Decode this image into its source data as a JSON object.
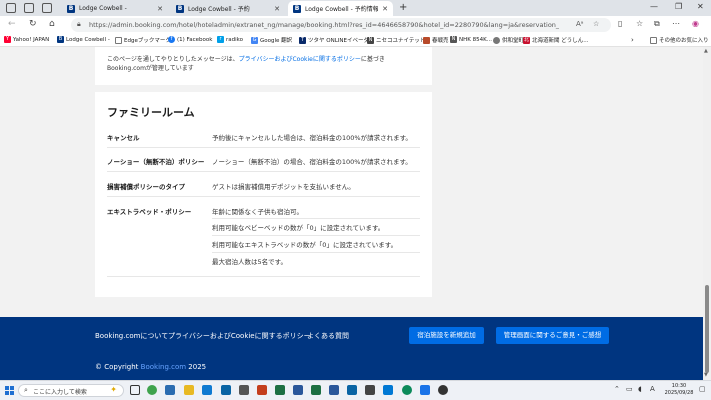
{
  "browser": {
    "tabs": [
      {
        "title": "Lodge Cowbell -",
        "active": false
      },
      {
        "title": "Lodge Cowbell - 予約",
        "active": false
      },
      {
        "title": "Lodge Cowbell - 予約情報",
        "active": true
      }
    ],
    "url": "https://admin.booking.com/hotel/hoteladmin/extranet_ng/manage/booking.html?res_id=4646658790&hotel_id=2280790&lang=ja&reservation_status=ok&reserva...",
    "bookmarks": [
      {
        "label": "Yahoo! JAPAN",
        "icon": "Y!",
        "color": "#ff0033"
      },
      {
        "label": "Lodge Cowbell -",
        "icon": "B",
        "color": "#003580"
      },
      {
        "label": "Edgeブックマーク",
        "icon": "□",
        "color": "#7a7a7a"
      },
      {
        "label": "(1) Facebook",
        "icon": "f",
        "color": "#1877f2"
      },
      {
        "label": "radiko",
        "icon": "r",
        "color": "#00a0e9"
      },
      {
        "label": "Google 翻訳",
        "icon": "G",
        "color": "#4285f4"
      },
      {
        "label": "ツタヤ ONLINEイベーダ",
        "icon": "T",
        "color": "#0a2a6a"
      },
      {
        "label": "ニセコユナイテッド",
        "icon": "N",
        "color": "#444444"
      },
      {
        "label": "春戦売",
        "icon": "■",
        "color": "#b84a2a"
      },
      {
        "label": "NHK 854K...",
        "icon": "N",
        "color": "#555555"
      },
      {
        "label": "供和堂町",
        "icon": "◎",
        "color": "#777777"
      },
      {
        "label": "北海道新聞 どうしん...",
        "icon": "北",
        "color": "#c8102e"
      }
    ],
    "bookmarks_other": "その他のお気に入り"
  },
  "page": {
    "message_text": "このページを通してやりとりしたメッセージは、",
    "message_link": "プライバシーおよびCookieに関するポリシー",
    "message_text2": "に基づきBooking.comが管理しています",
    "section_title": "ファミリールーム",
    "policies": [
      {
        "label": "キャンセル",
        "value": "予約後にキャンセルした場合は、宿泊料金の100%が請求されます。"
      },
      {
        "label": "ノーショー（無断不泊）ポリシー",
        "value": "ノーショー（無断不泊）の場合、宿泊料金の100%が請求されます。"
      },
      {
        "label": "損害補償ポリシーのタイプ",
        "value": "ゲストは損害補償用デポジットを支払いません。"
      },
      {
        "label": "エキストラベッド・ポリシー",
        "value": "年齢に関係なく子供も宿泊可。"
      }
    ],
    "extra_bed_lines": [
      "利用可能なベビーベッドの数が「0」に設定されています。",
      "利用可能なエキストラベッドの数が「0」に設定されています。",
      "最大宿泊人数は5名です。"
    ]
  },
  "footer": {
    "links": [
      "Booking.comについて",
      "プライバシーおよびCookieに関するポリシー",
      "よくある質問"
    ],
    "button_add": "宿泊施設を新規追加",
    "button_feedback": "管理画面に関するご意見・ご感想",
    "copyright_prefix": "© Copyright ",
    "copyright_link": "Booking.com",
    "copyright_year": " 2025"
  },
  "taskbar": {
    "search_placeholder": "ここに入力して検索",
    "ime_label": "A",
    "time": "10:30",
    "date": "2025/09/28"
  },
  "colors": {
    "brand_dark": "#003580",
    "brand_blue": "#006ce4"
  }
}
